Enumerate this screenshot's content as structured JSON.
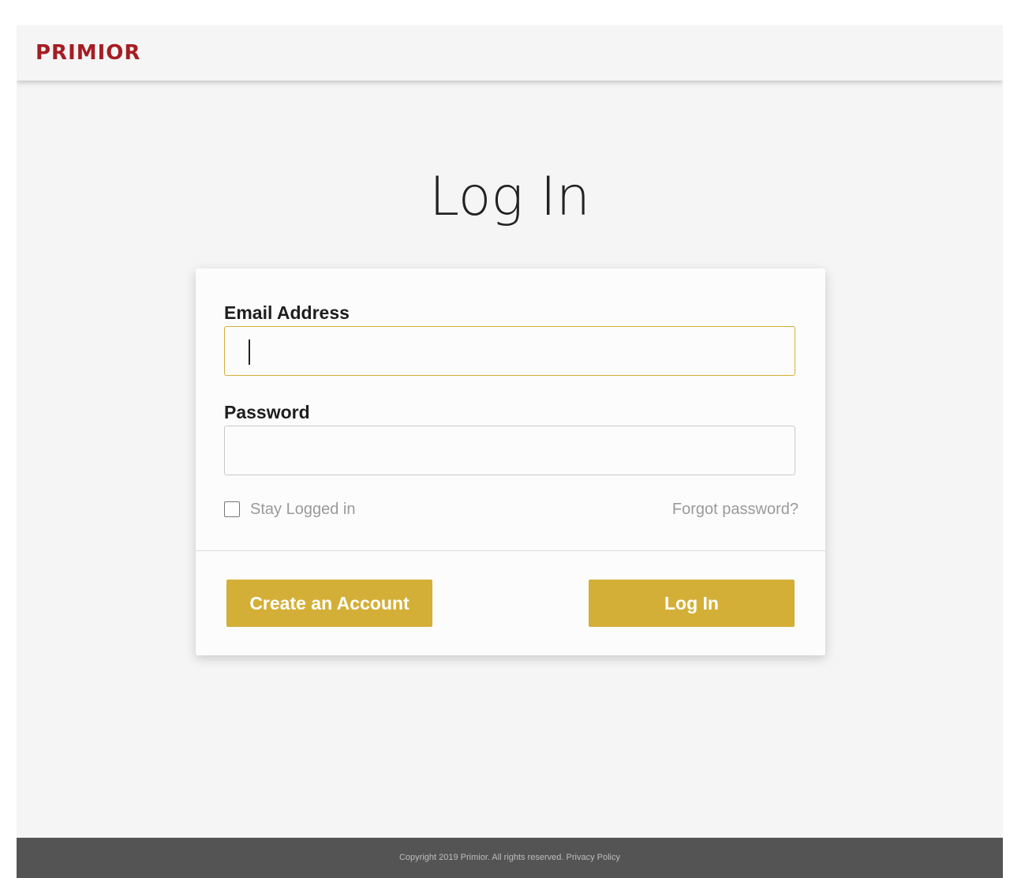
{
  "brand": {
    "logo_text": "PRIMIOR",
    "logo_color": "#a51d24"
  },
  "page": {
    "title": "Log In"
  },
  "form": {
    "email_label": "Email Address",
    "email_value": "",
    "password_label": "Password",
    "password_value": "",
    "stay_logged_in_label": "Stay Logged in",
    "stay_logged_in_checked": false,
    "forgot_password_label": "Forgot password?",
    "create_account_label": "Create an Account",
    "login_button_label": "Log In"
  },
  "footer": {
    "copyright": "Copyright 2019 Primior. All rights reserved.",
    "privacy_link": "Privacy Policy"
  },
  "colors": {
    "accent": "#d4af37",
    "background": "#f5f5f5",
    "footer_bg": "#545454"
  }
}
